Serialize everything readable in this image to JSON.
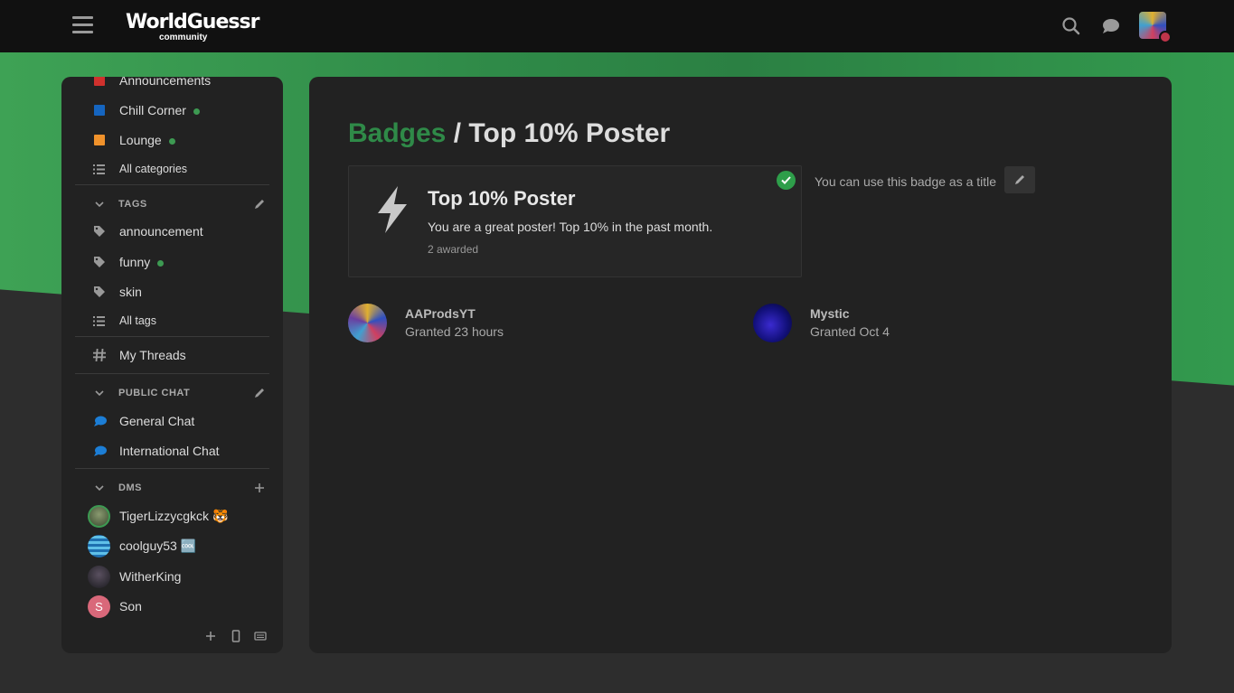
{
  "header": {
    "logo_text": "WorldGuessr",
    "logo_sub": "community"
  },
  "sidebar": {
    "categories": [
      {
        "label": "Announcements",
        "color": "#d0312d",
        "dot": false
      },
      {
        "label": "Chill Corner",
        "color": "#1565c0",
        "dot": true
      },
      {
        "label": "Lounge",
        "color": "#f0922b",
        "dot": true
      }
    ],
    "all_categories": "All categories",
    "tags_title": "TAGS",
    "tags": [
      {
        "label": "announcement",
        "dot": false
      },
      {
        "label": "funny",
        "dot": true
      },
      {
        "label": "skin",
        "dot": false
      }
    ],
    "all_tags": "All tags",
    "my_threads": "My Threads",
    "public_chat_title": "PUBLIC CHAT",
    "channels": [
      {
        "label": "General Chat"
      },
      {
        "label": "International Chat"
      }
    ],
    "dms_title": "DMS",
    "dms": [
      {
        "label": "TigerLizzycgkck",
        "emoji": "🐯"
      },
      {
        "label": "coolguy53",
        "emoji": "🆒"
      },
      {
        "label": "WitherKing",
        "emoji": ""
      },
      {
        "label": "Son",
        "emoji": "",
        "initial": "S"
      }
    ]
  },
  "main": {
    "breadcrumb": "Badges",
    "separator": " / ",
    "title": "Top 10% Poster",
    "badge": {
      "name": "Top 10% Poster",
      "description": "You are a great poster! Top 10% in the past month.",
      "awarded": "2 awarded"
    },
    "title_note": "You can use this badge as a title",
    "users": [
      {
        "name": "AAProdsYT",
        "granted": "Granted 23 hours"
      },
      {
        "name": "Mystic",
        "granted": "Granted Oct 4"
      }
    ]
  },
  "colors": {
    "accent_green": "#2f8a48",
    "check_green": "#2e9e4a",
    "online_dot": "#3d9a52"
  }
}
